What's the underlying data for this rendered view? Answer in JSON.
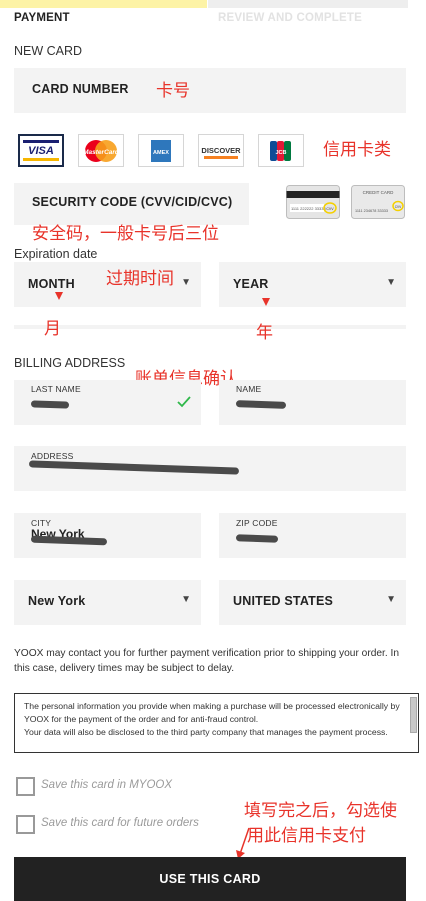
{
  "steps": {
    "payment": "PAYMENT",
    "review": "REVIEW AND COMPLETE"
  },
  "new_card_label": "NEW CARD",
  "card_number": {
    "placeholder": "CARD NUMBER",
    "note": "卡号"
  },
  "card_types": {
    "note": "信用卡类",
    "logos": [
      "VISA",
      "MasterCard",
      "AMEX",
      "DISCOVER",
      "JCB"
    ]
  },
  "security_code": {
    "placeholder": "SECURITY CODE (CVV/CID/CVC)",
    "note": "安全码，一般卡号后三位",
    "card_back_text": "1111 222222 33333",
    "card_front_label": "CREDIT CARD",
    "card_front_number": "1111 234678 33333",
    "cvv_badge": "CVV"
  },
  "expiration": {
    "label": "Expiration date",
    "note": "过期时间",
    "month": "MONTH",
    "month_note": "月",
    "year": "YEAR",
    "year_note": "年"
  },
  "billing": {
    "label": "BILLING ADDRESS",
    "note": "账单信息确认",
    "last_name_label": "LAST NAME",
    "name_label": "NAME",
    "address_label": "ADDRESS",
    "city_label": "CITY",
    "city_value": "New York",
    "zip_label": "ZIP CODE",
    "state_value": "New York",
    "country_value": "UNITED STATES"
  },
  "colors": {
    "valid_check": "#2fb84a",
    "annotation": "#e8332a"
  },
  "icons": {
    "valid": "checkmark-icon",
    "dropdown": "chevron-down-icon"
  },
  "disclaimer": "YOOX may contact you for further payment verification prior to shipping your order. In this case, delivery times may be subject to delay.",
  "privacy": {
    "p1": "The personal information you provide when making a purchase will be processed electronically by YOOX for the payment of the order and for anti-fraud control.",
    "p2": "Your data will also be disclosed to the third party company that manages the payment process."
  },
  "options": {
    "save_myoox": "Save this card in MYOOX",
    "save_future": "Save this card for future orders"
  },
  "final_note": {
    "line1": "填写完之后，勾选使",
    "line2": "用此信用卡支付"
  },
  "submit_label": "USE THIS CARD"
}
